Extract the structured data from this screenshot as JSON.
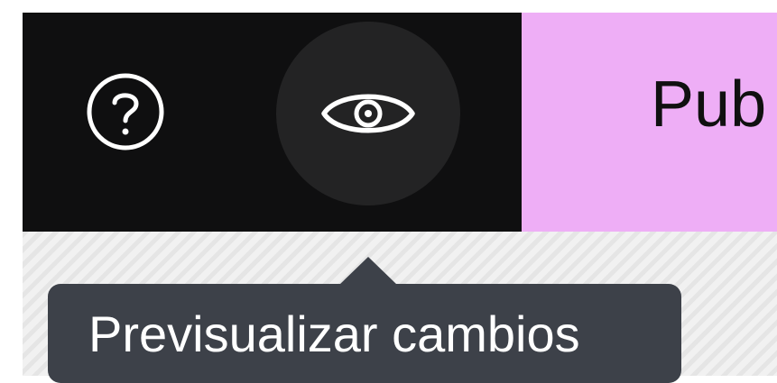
{
  "toolbar": {
    "help_icon": "help-circle-icon",
    "preview_icon": "eye-icon",
    "publish_label": "Pub"
  },
  "tooltip": {
    "text": "Previsualizar cambios"
  },
  "colors": {
    "toolbar_bg": "#0f0f10",
    "preview_hover_bg": "#232324",
    "publish_bg": "#eeaef6",
    "tooltip_bg": "#3d4149"
  }
}
